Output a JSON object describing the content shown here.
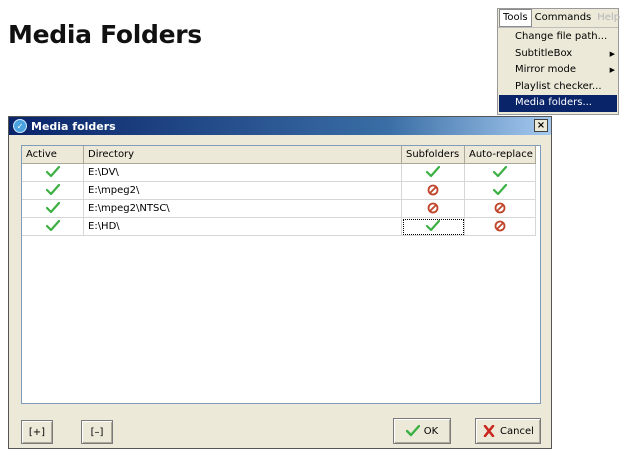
{
  "page_title": "Media Folders",
  "menu": {
    "bar": [
      "Tools",
      "Commands",
      "Help"
    ],
    "items": [
      {
        "label": "Change file path...",
        "submenu": false
      },
      {
        "label": "SubtitleBox",
        "submenu": true
      },
      {
        "label": "Mirror mode",
        "submenu": true
      },
      {
        "label": "Playlist checker...",
        "submenu": false
      },
      {
        "label": "Media folders...",
        "submenu": false,
        "selected": true
      }
    ]
  },
  "dialog": {
    "title": "Media folders",
    "close_label": "×",
    "columns": [
      "Active",
      "Directory",
      "Subfolders",
      "Auto-replace"
    ],
    "rows": [
      {
        "active": true,
        "directory": "E:\\DV\\",
        "subfolders": true,
        "auto_replace": true
      },
      {
        "active": true,
        "directory": "E:\\mpeg2\\",
        "subfolders": false,
        "auto_replace": true
      },
      {
        "active": true,
        "directory": "E:\\mpeg2\\NTSC\\",
        "subfolders": false,
        "auto_replace": false
      },
      {
        "active": true,
        "directory": "E:\\HD\\",
        "subfolders": true,
        "auto_replace": false
      }
    ],
    "add_button_label": "[+]",
    "remove_button_label": "[–]",
    "ok_label": "OK",
    "cancel_label": "Cancel"
  },
  "colors": {
    "check": "#3cb043",
    "no": "#c0442a",
    "selection": "#0a246a"
  }
}
